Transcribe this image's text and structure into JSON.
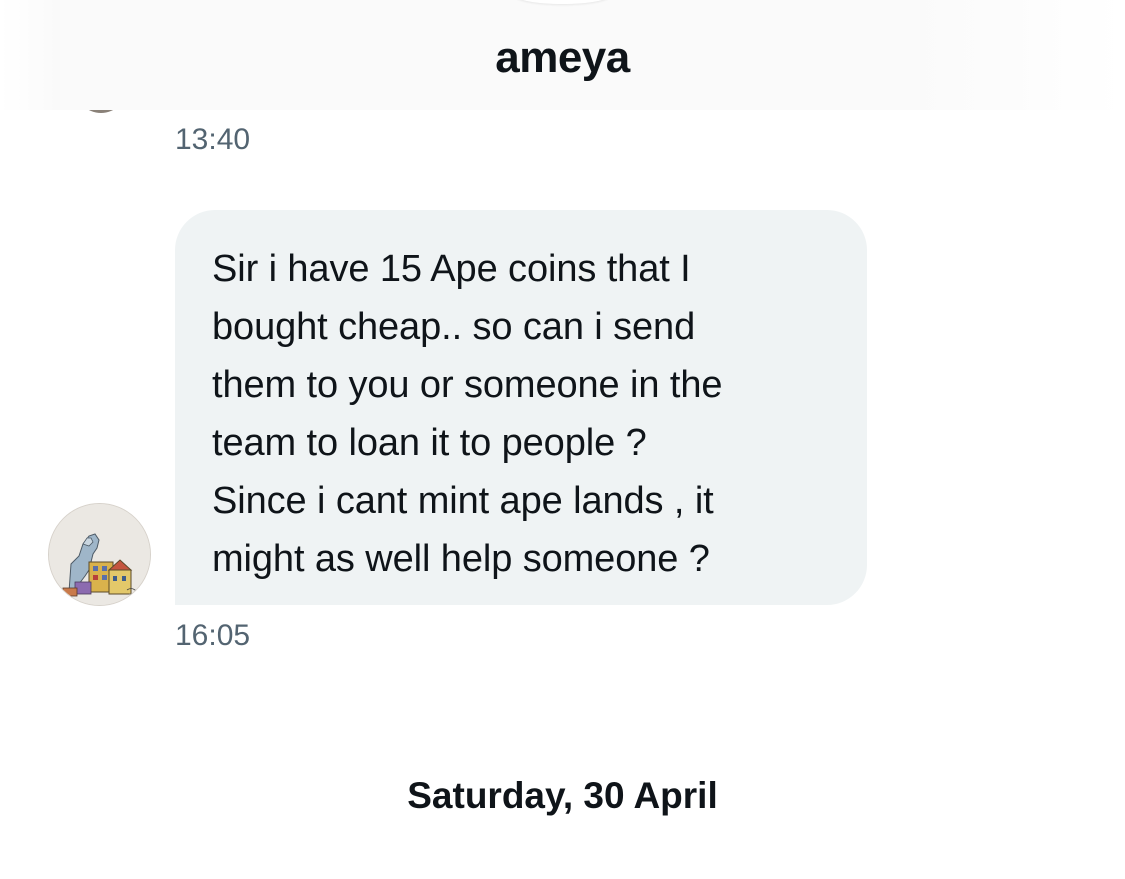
{
  "header": {
    "title": "ameya"
  },
  "conversation": {
    "messages": [
      {
        "timestamp": "13:40"
      },
      {
        "text": "Sir i have 15 Ape coins that I\nbought cheap.. so can i send\nthem to you or someone in the\nteam to loan it to people ?\nSince i cant mint ape lands , it\nmight as well help someone ?",
        "timestamp": "16:05"
      }
    ],
    "date_separator": "Saturday, 30 April"
  },
  "colors": {
    "bubble_background": "#eff3f4",
    "timestamp_text": "#536471",
    "primary_text": "#0f1419"
  },
  "icons": {
    "avatar": "sender-avatar"
  }
}
